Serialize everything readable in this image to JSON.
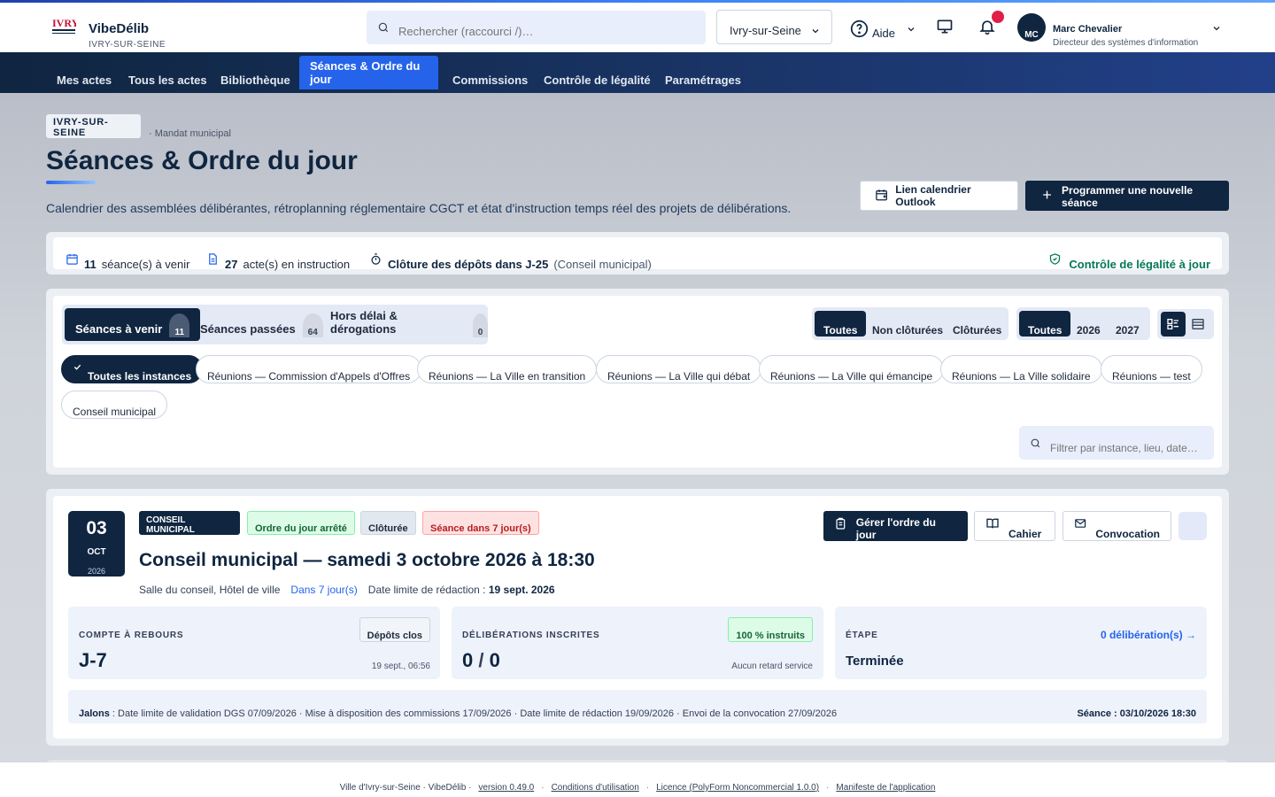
{
  "app": {
    "brand_name": "VibeDélib",
    "brand_sub": "IVRY-SUR-SEINE",
    "search_placeholder": "Rechercher (raccourci /)…",
    "city_select": "Ivry-sur-Seine",
    "help_label": "Aide",
    "user_initials": "MC",
    "user_name": "Marc Chevalier",
    "user_role": "Directeur des systèmes d'information"
  },
  "nav": {
    "items": [
      {
        "label": "Mes actes"
      },
      {
        "label": "Tous les actes"
      },
      {
        "label": "Bibliothèque"
      },
      {
        "label": "Séances & Ordre du jour"
      },
      {
        "label": "Commissions"
      },
      {
        "label": "Contrôle de légalité"
      },
      {
        "label": "Paramétrages"
      }
    ],
    "active_index": 3
  },
  "page": {
    "crumb_city": "IVRY-SUR-SEINE",
    "crumb_rest": "· Mandat municipal",
    "title": "Séances & Ordre du jour",
    "description": "Calendrier des assemblées délibérantes, rétroplanning réglementaire CGCT et état d'instruction temps réel des projets de délibérations.",
    "btn_outlook": "Lien calendrier Outlook",
    "btn_new": "Programmer une nouvelle séance"
  },
  "stats": {
    "upcoming_count": "11",
    "upcoming_label": "séance(s) à venir",
    "instruction_count": "27",
    "instruction_label": "acte(s) en instruction",
    "deposit_close": "Clôture des dépôts dans J-25",
    "deposit_note": "(Conseil municipal)",
    "legality": "Contrôle de légalité à jour"
  },
  "filters": {
    "tabs": [
      {
        "label": "Séances à venir",
        "count": "11"
      },
      {
        "label": "Séances passées",
        "count": "64"
      },
      {
        "label": "Hors délai & dérogations",
        "count": "0"
      }
    ],
    "status": [
      "Toutes",
      "Non clôturées",
      "Clôturées"
    ],
    "years": [
      "Toutes",
      "2026",
      "2027"
    ],
    "chips": [
      "Toutes les instances",
      "Réunions — Commission d'Appels d'Offres",
      "Réunions — La Ville en transition",
      "Réunions — La Ville qui débat",
      "Réunions — La Ville qui émancipe",
      "Réunions — La Ville solidaire",
      "Réunions — test",
      "Conseil municipal"
    ],
    "search_placeholder": "Filtrer par instance, lieu, date…"
  },
  "session": {
    "day": "03",
    "month": "OCT",
    "year": "2026",
    "badges": {
      "instance": "CONSEIL MUNICIPAL",
      "agenda": "Ordre du jour arrêté",
      "closed": "Clôturée",
      "soon": "Séance dans 7 jour(s)"
    },
    "title": "Conseil municipal — samedi 3 octobre 2026 à 18:30",
    "place": "Salle du conseil, Hôtel de ville",
    "in_days": "Dans 7 jour(s)",
    "deadline_label": "Date limite de rédaction :",
    "deadline_value": "19 sept. 2026",
    "actions": {
      "manage": "Gérer l'ordre du jour",
      "book": "Cahier",
      "convocation": "Convocation"
    },
    "kpi": {
      "countdown_label": "COMPTE À REBOURS",
      "countdown_value": "J-7",
      "countdown_pill": "Dépôts clos",
      "countdown_sub": "19 sept., 06:56",
      "delib_label": "DÉLIBÉRATIONS INSCRITES",
      "delib_value_a": "0",
      "delib_value_sep": "/",
      "delib_value_b": "0",
      "delib_pill": "100 % instruits",
      "delib_sub": "Aucun retard service",
      "step_label": "ÉTAPE",
      "step_value": "Terminée",
      "step_link": "0 délibération(s) →"
    },
    "milestones_label": "Jalons",
    "milestones_text": " : Date limite de validation DGS 07/09/2026 · Mise à disposition des commissions 17/09/2026 · Date limite de rédaction 19/09/2026 · Envoi de la convocation 27/09/2026",
    "milestones_right": "Séance : 03/10/2026 18:30"
  },
  "footer": {
    "prefix": "Ville d'Ivry-sur-Seine · VibeDélib ·",
    "version": "version 0.49.0",
    "terms": "Conditions d'utilisation",
    "license": "Licence (PolyForm Noncommercial 1.0.0)",
    "manifesto": "Manifeste de l'application"
  },
  "colors": {
    "primary": "#0f2540",
    "accent": "#2563eb",
    "success": "#047857",
    "danger": "#e11d48"
  }
}
